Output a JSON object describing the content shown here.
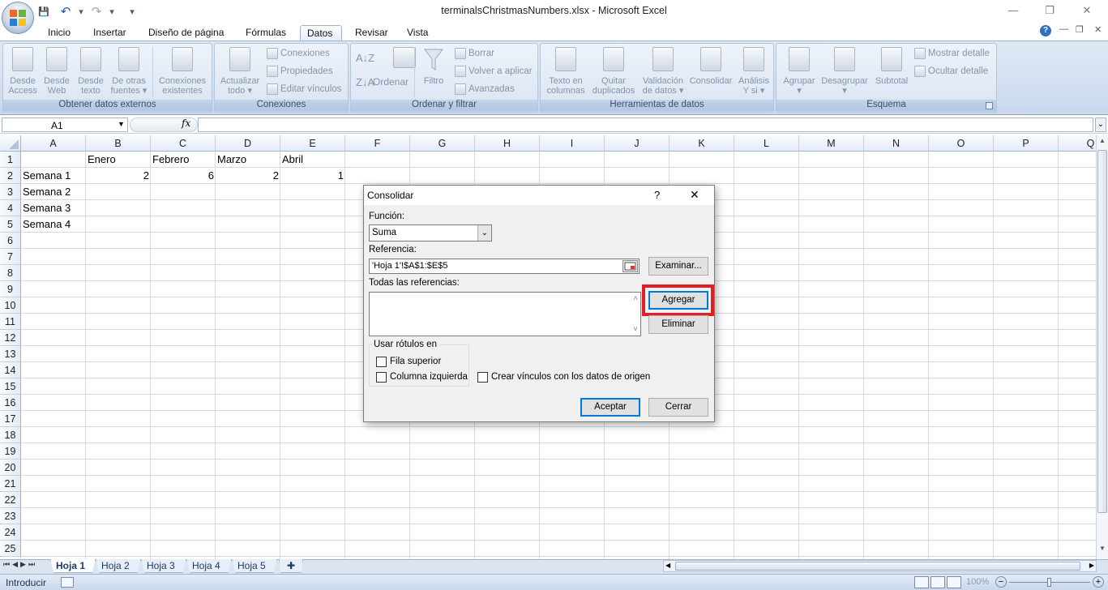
{
  "window": {
    "title": "terminalsChristmasNumbers.xlsx - Microsoft Excel",
    "minimize": "—",
    "restore": "❐",
    "close": "✕"
  },
  "qat": {
    "save": "💾",
    "undo": "↶",
    "redo": "↷",
    "customize": "▾"
  },
  "tabs": [
    "Inicio",
    "Insertar",
    "Diseño de página",
    "Fórmulas",
    "Datos",
    "Revisar",
    "Vista"
  ],
  "ribbon": {
    "groups": {
      "external": "Obtener datos externos",
      "connections": "Conexiones",
      "sort": "Ordenar y filtrar",
      "tools": "Herramientas de datos",
      "outline": "Esquema"
    },
    "external": {
      "access": [
        "Desde",
        "Access"
      ],
      "web": [
        "Desde",
        "Web"
      ],
      "text": [
        "Desde",
        "texto"
      ],
      "other": [
        "De otras",
        "fuentes ▾"
      ],
      "existing": [
        "Conexiones",
        "existentes"
      ]
    },
    "connections": {
      "refresh": [
        "Actualizar",
        "todo ▾"
      ],
      "conn": "Conexiones",
      "props": "Propiedades",
      "edit": "Editar vínculos"
    },
    "sort": {
      "sort": "Ordenar",
      "filter": "Filtro",
      "clear": "Borrar",
      "reapply": "Volver a aplicar",
      "advanced": "Avanzadas"
    },
    "tools": {
      "text": [
        "Texto en",
        "columnas"
      ],
      "dup": [
        "Quitar",
        "duplicados"
      ],
      "valid": [
        "Validación",
        "de datos ▾"
      ],
      "consol": "Consolidar",
      "whatif": [
        "Análisis",
        "Y si ▾"
      ]
    },
    "outline": {
      "group": [
        "Agrupar",
        "▾"
      ],
      "ungroup": [
        "Desagrupar",
        "▾"
      ],
      "subtotal": "Subtotal",
      "show": "Mostrar detalle",
      "hide": "Ocultar detalle"
    }
  },
  "formula_bar": {
    "name_box": "A1",
    "fx": "fx",
    "formula": ""
  },
  "columns": [
    "A",
    "B",
    "C",
    "D",
    "E",
    "F",
    "G",
    "H",
    "I",
    "J",
    "K",
    "L",
    "M",
    "N",
    "O",
    "P",
    "Q"
  ],
  "rows": [
    "1",
    "2",
    "3",
    "4",
    "5",
    "6",
    "7",
    "8",
    "9",
    "10",
    "11",
    "12",
    "13",
    "14",
    "15",
    "16",
    "17",
    "18",
    "19",
    "20",
    "21",
    "22",
    "23",
    "24",
    "25"
  ],
  "cells": {
    "B1": "Enero",
    "C1": "Febrero",
    "D1": "Marzo",
    "E1": "Abril",
    "A2": "Semana 1",
    "B2": "2",
    "C2": "6",
    "D2": "2",
    "E2": "1",
    "A3": "Semana 2",
    "A4": "Semana 3",
    "A5": "Semana 4"
  },
  "sheet_tabs": [
    "Hoja 1",
    "Hoja 2",
    "Hoja 3",
    "Hoja 4",
    "Hoja 5"
  ],
  "status": {
    "mode": "Introducir",
    "zoom": "100%"
  },
  "dialog": {
    "title": "Consolidar",
    "help": "?",
    "close": "✕",
    "function_label": "Función:",
    "function_value": "Suma",
    "reference_label": "Referencia:",
    "reference_value": "'Hoja 1'!$A$1:$E$5",
    "browse": "Examinar...",
    "all_refs_label": "Todas las referencias:",
    "add": "Agregar",
    "delete": "Eliminar",
    "labels_group": "Usar rótulos en",
    "top_row": "Fila superior",
    "left_col": "Columna izquierda",
    "links": "Crear vínculos con los datos de origen",
    "ok": "Aceptar",
    "cancel": "Cerrar"
  }
}
